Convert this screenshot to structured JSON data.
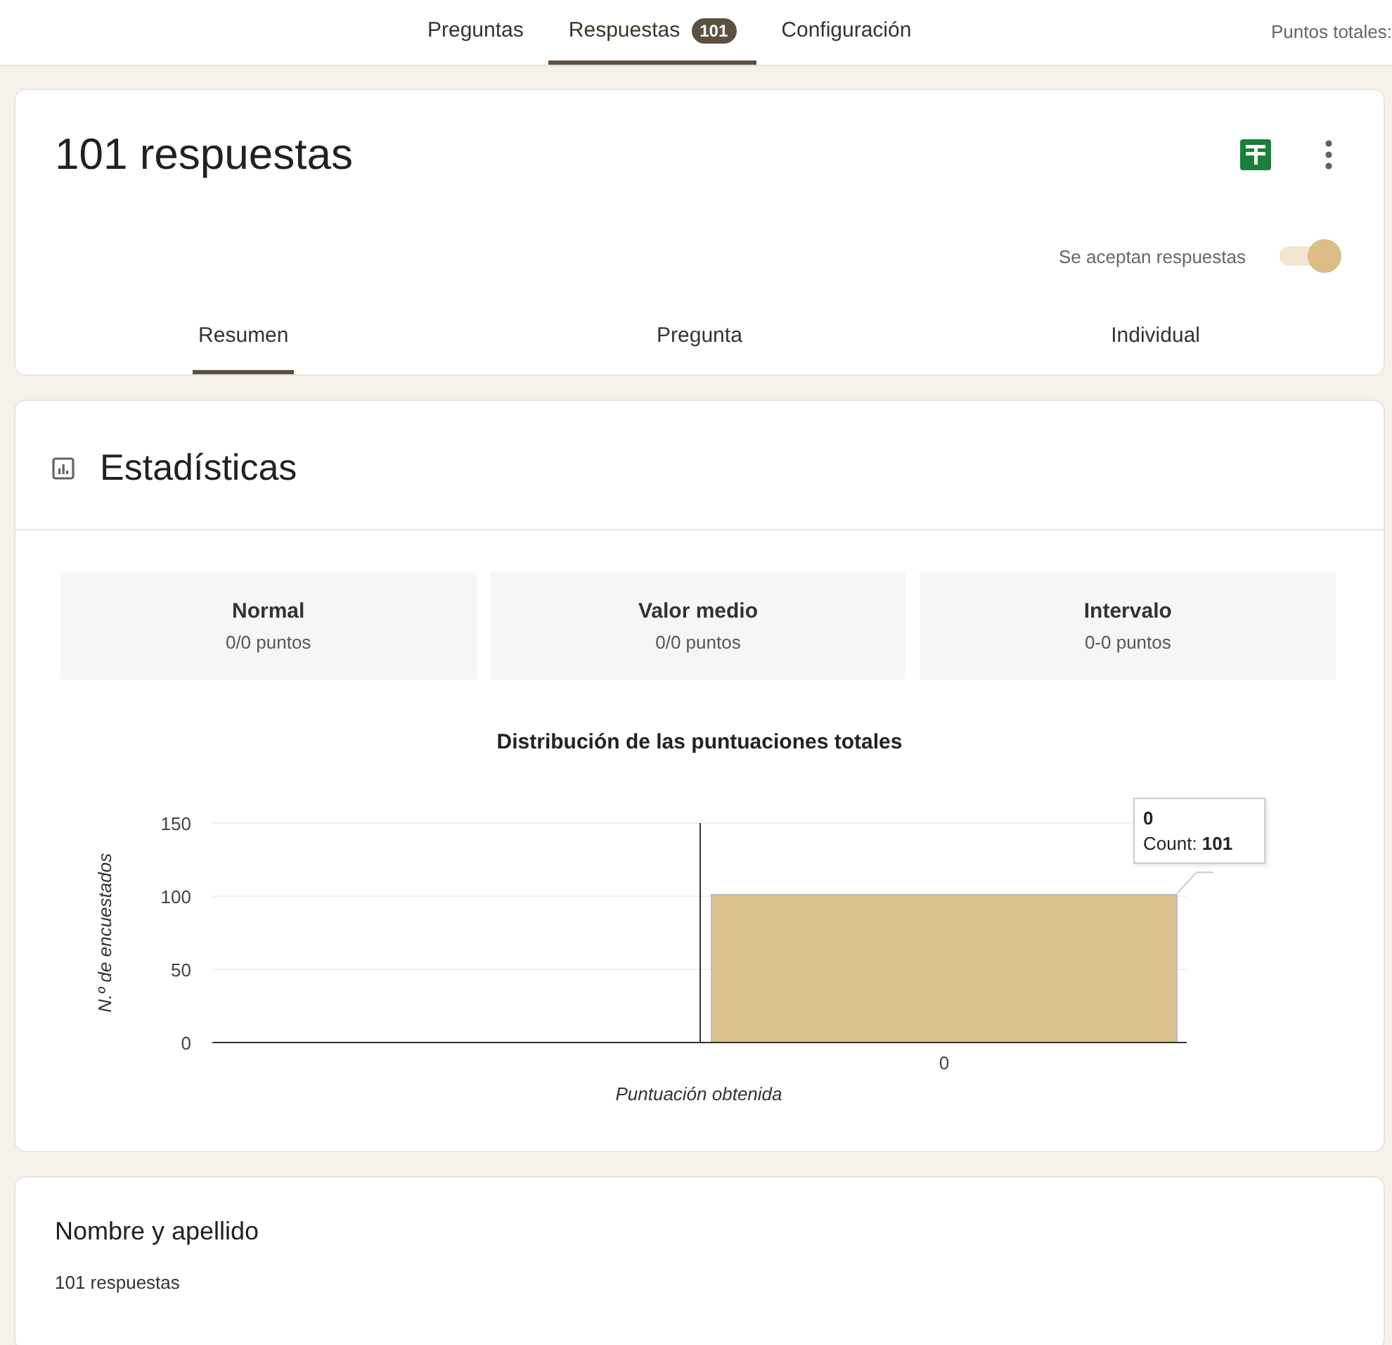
{
  "top_tabs": [
    {
      "label": "Preguntas",
      "selected": false
    },
    {
      "label": "Respuestas",
      "selected": true,
      "badge": "101"
    },
    {
      "label": "Configuración",
      "selected": false
    }
  ],
  "total_points": "Puntos totales:",
  "summary_card": {
    "title": "101 respuestas",
    "accepting_label": "Se aceptan respuestas",
    "accepting": true,
    "tabs": [
      {
        "label": "Resumen",
        "selected": true
      },
      {
        "label": "Pregunta",
        "selected": false
      },
      {
        "label": "Individual",
        "selected": false
      }
    ]
  },
  "statistics": {
    "title": "Estadísticas",
    "stats": [
      {
        "label": "Normal",
        "value": "0/0 puntos"
      },
      {
        "label": "Valor medio",
        "value": "0/0 puntos"
      },
      {
        "label": "Intervalo",
        "value": "0-0 puntos"
      }
    ],
    "chart_data": {
      "type": "bar",
      "title": "Distribución de las puntuaciones totales",
      "xlabel": "Puntuación obtenida",
      "ylabel": "N.º de encuestados",
      "categories": [
        "0"
      ],
      "values": [
        101
      ],
      "ylim": [
        0,
        150
      ],
      "yticks": [
        0,
        50,
        100,
        150
      ]
    },
    "tooltip": {
      "title": "0",
      "text": "Count: **101**"
    }
  },
  "question": {
    "title": "Nombre y apellido",
    "count": "101 respuestas"
  }
}
